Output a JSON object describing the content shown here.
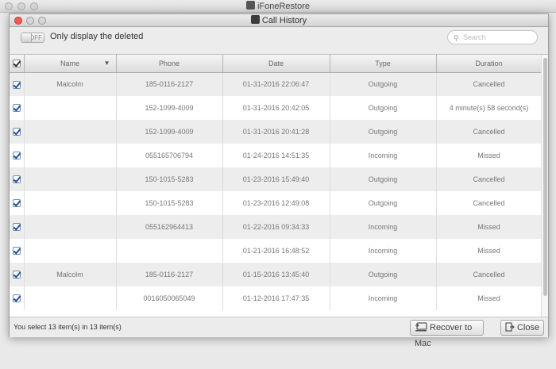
{
  "app": {
    "title": "iFoneRestore"
  },
  "dialog": {
    "title": "Call History"
  },
  "toolbar": {
    "toggle_state": "OFF",
    "filter_label": "Only display the deleted",
    "search_placeholder": "Search",
    "search_value": ""
  },
  "table": {
    "columns": [
      "Name",
      "Phone",
      "Date",
      "Type",
      "Duration"
    ],
    "rows": [
      {
        "name": "Malcolm",
        "phone": "185-0116-2127",
        "date": "01-31-2016 22:06:47",
        "type": "Outgoing",
        "duration": "Cancelled"
      },
      {
        "name": "",
        "phone": "152-1099-4009",
        "date": "01-31-2016 20:42:05",
        "type": "Outgoing",
        "duration": "4 minute(s) 58 second(s)"
      },
      {
        "name": "",
        "phone": "152-1099-4009",
        "date": "01-31-2016 20:41:28",
        "type": "Outgoing",
        "duration": "Cancelled"
      },
      {
        "name": "",
        "phone": "055165706794",
        "date": "01-24-2016 14:51:35",
        "type": "Incoming",
        "duration": "Missed"
      },
      {
        "name": "",
        "phone": "150-1015-5283",
        "date": "01-23-2016 15:49:40",
        "type": "Outgoing",
        "duration": "Cancelled"
      },
      {
        "name": "",
        "phone": "150-1015-5283",
        "date": "01-23-2016 12:49:08",
        "type": "Outgoing",
        "duration": "Cancelled"
      },
      {
        "name": "",
        "phone": "055162964413",
        "date": "01-22-2016 09:34:33",
        "type": "Incoming",
        "duration": "Missed"
      },
      {
        "name": "",
        "phone": "",
        "date": "01-21-2016 16:48:52",
        "type": "Incoming",
        "duration": "Missed"
      },
      {
        "name": "Malcolm",
        "phone": "185-0116-2127",
        "date": "01-15-2016 13:45:40",
        "type": "Outgoing",
        "duration": "Cancelled"
      },
      {
        "name": "",
        "phone": "0016050065049",
        "date": "01-12-2016 17:47:35",
        "type": "Incoming",
        "duration": "Missed"
      }
    ]
  },
  "footer": {
    "status": "You select 13 item(s) in 13 item(s)",
    "recover_label": "Recover to Mac",
    "close_label": "Close"
  }
}
